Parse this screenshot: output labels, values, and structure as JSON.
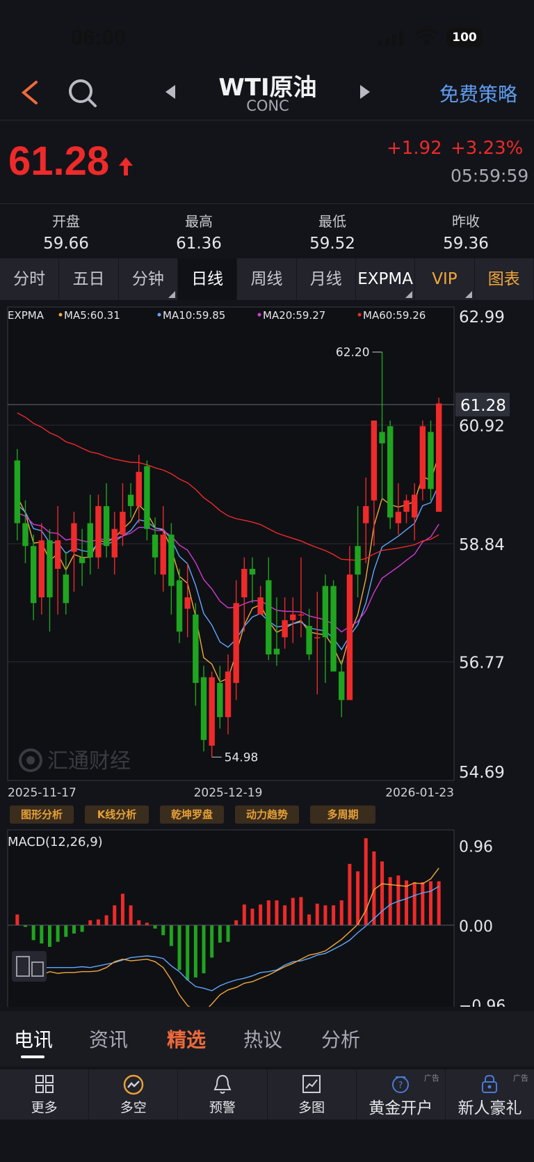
{
  "status": {
    "time": "06:00",
    "battery": "100"
  },
  "header": {
    "title": "WTI原油",
    "subtitle": "CONC",
    "strategy_label": "免费策略"
  },
  "quote": {
    "price": "61.28",
    "change": "+1.92",
    "change_pct": "+3.23%",
    "time": "05:59:59",
    "up_color": "#ef2a2a",
    "down_color": "#1fa51f"
  },
  "stats": [
    {
      "label": "开盘",
      "value": "59.66"
    },
    {
      "label": "最高",
      "value": "61.36"
    },
    {
      "label": "最低",
      "value": "59.52"
    },
    {
      "label": "昨收",
      "value": "59.36"
    }
  ],
  "period_tabs": [
    {
      "label": "分时"
    },
    {
      "label": "五日"
    },
    {
      "label": "分钟"
    },
    {
      "label": "日线",
      "active": true
    },
    {
      "label": "周线"
    },
    {
      "label": "月线"
    },
    {
      "label": "EXPMA"
    },
    {
      "label": "VIP"
    },
    {
      "label": "图表"
    }
  ],
  "chart_data": [
    {
      "type": "candlestick",
      "indicator": "EXPMA",
      "legend": [
        {
          "label": "MA5:60.31",
          "color": "#f2a93b"
        },
        {
          "label": "MA10:59.85",
          "color": "#5fa8ff"
        },
        {
          "label": "MA20:59.27",
          "color": "#d63ad6"
        },
        {
          "label": "MA60:59.26",
          "color": "#ef2a2a"
        }
      ],
      "y_ticks": [
        "62.99",
        "60.92",
        "58.84",
        "56.77",
        "54.69"
      ],
      "ylim": [
        54.69,
        62.99
      ],
      "current_price_label": "61.28",
      "x_ticks": [
        "2025-11-17",
        "2025-12-19",
        "2026-01-23"
      ],
      "max_label": "62.20",
      "min_label": "54.98",
      "watermark": "汇通财经",
      "candles": [
        [
          60.3,
          59.2,
          60.5,
          58.9
        ],
        [
          59.2,
          58.8,
          59.6,
          58.5
        ],
        [
          58.8,
          57.8,
          59.0,
          57.5
        ],
        [
          57.9,
          58.9,
          59.2,
          57.6
        ],
        [
          58.9,
          57.9,
          59.1,
          57.3
        ],
        [
          58.4,
          58.9,
          59.5,
          57.6
        ],
        [
          58.3,
          57.8,
          58.7,
          57.6
        ],
        [
          58.7,
          59.2,
          59.4,
          58.0
        ],
        [
          58.6,
          58.5,
          59.1,
          58.1
        ],
        [
          59.2,
          58.6,
          59.7,
          58.3
        ],
        [
          58.6,
          59.5,
          59.7,
          58.4
        ],
        [
          59.5,
          58.8,
          59.9,
          58.6
        ],
        [
          58.6,
          59.1,
          59.4,
          58.3
        ],
        [
          59.0,
          59.4,
          59.9,
          58.8
        ],
        [
          59.7,
          59.5,
          59.9,
          59.3
        ],
        [
          59.5,
          60.1,
          60.4,
          59.2
        ],
        [
          60.2,
          59.1,
          60.3,
          58.9
        ],
        [
          59.0,
          58.6,
          59.3,
          58.3
        ],
        [
          58.3,
          59.0,
          59.5,
          58.0
        ],
        [
          59.0,
          58.1,
          59.2,
          57.6
        ],
        [
          58.2,
          57.3,
          58.4,
          57.1
        ],
        [
          57.7,
          57.9,
          58.5,
          57.2
        ],
        [
          57.6,
          56.4,
          57.8,
          56.0
        ],
        [
          56.5,
          55.4,
          56.7,
          55.2
        ],
        [
          55.3,
          56.5,
          56.6,
          55.1
        ],
        [
          56.4,
          55.8,
          56.7,
          55.6
        ],
        [
          55.8,
          56.6,
          56.9,
          55.5
        ],
        [
          56.4,
          57.8,
          58.2,
          56.1
        ],
        [
          57.9,
          58.4,
          58.6,
          57.3
        ],
        [
          58.4,
          58.3,
          58.6,
          57.8
        ],
        [
          57.6,
          57.9,
          58.1,
          57.6
        ],
        [
          58.2,
          56.9,
          58.6,
          56.8
        ],
        [
          57.0,
          56.9,
          57.9,
          56.7
        ],
        [
          57.2,
          57.5,
          57.9,
          57.0
        ],
        [
          57.5,
          57.6,
          57.9,
          57.1
        ],
        [
          57.6,
          57.6,
          58.6,
          57.2
        ],
        [
          57.4,
          56.9,
          57.7,
          56.8
        ],
        [
          57.2,
          57.2,
          58.0,
          56.2
        ],
        [
          58.1,
          57.2,
          58.3,
          56.4
        ],
        [
          58.1,
          56.6,
          58.2,
          56.6
        ],
        [
          56.6,
          56.1,
          56.8,
          55.8
        ],
        [
          56.1,
          58.3,
          58.8,
          56.4
        ],
        [
          58.8,
          58.3,
          59.5,
          57.9
        ],
        [
          59.2,
          59.5,
          60.0,
          58.5
        ],
        [
          59.6,
          61.0,
          61.0,
          58.8
        ],
        [
          60.8,
          60.6,
          62.2,
          59.6
        ],
        [
          60.9,
          59.3,
          61.0,
          59.1
        ],
        [
          59.2,
          59.4,
          59.9,
          59.0
        ],
        [
          59.4,
          59.6,
          59.7,
          59.2
        ],
        [
          59.3,
          59.7,
          59.9,
          58.9
        ],
        [
          59.8,
          60.9,
          61.0,
          59.6
        ],
        [
          60.8,
          59.8,
          61.0,
          59.6
        ],
        [
          59.4,
          61.3,
          61.4,
          59.5
        ]
      ]
    },
    {
      "type": "bar",
      "indicator": "MACD",
      "title": "MACD(12,26,9)",
      "y_ticks": [
        "0.96",
        "0.00",
        "-0.96"
      ],
      "ylim": [
        -1.0,
        1.15
      ],
      "histogram": [
        0.13,
        -0.02,
        -0.18,
        -0.22,
        -0.26,
        -0.2,
        -0.14,
        -0.1,
        -0.08,
        0.06,
        0.07,
        0.12,
        0.24,
        0.38,
        0.24,
        0.06,
        0.03,
        -0.04,
        -0.12,
        -0.25,
        -0.54,
        -0.66,
        -0.63,
        -0.58,
        -0.39,
        -0.21,
        -0.2,
        0.06,
        0.25,
        0.2,
        0.25,
        0.3,
        0.3,
        0.24,
        0.33,
        0.34,
        0.13,
        0.26,
        0.24,
        0.24,
        0.3,
        0.74,
        0.65,
        1.05,
        0.89,
        0.77,
        0.58,
        0.6,
        0.54,
        0.52,
        0.52,
        0.53,
        0.53
      ],
      "dif": [
        -0.38,
        -0.46,
        -0.58,
        -0.6,
        -0.56,
        -0.58,
        -0.57,
        -0.57,
        -0.56,
        -0.56,
        -0.55,
        -0.51,
        -0.44,
        -0.41,
        -0.43,
        -0.42,
        -0.41,
        -0.44,
        -0.51,
        -0.66,
        -0.84,
        -0.97,
        -1.03,
        -1.05,
        -0.95,
        -0.84,
        -0.78,
        -0.75,
        -0.7,
        -0.68,
        -0.64,
        -0.6,
        -0.55,
        -0.5,
        -0.46,
        -0.41,
        -0.36,
        -0.34,
        -0.31,
        -0.24,
        -0.17,
        -0.08,
        0.01,
        0.18,
        0.43,
        0.5,
        0.49,
        0.48,
        0.47,
        0.51,
        0.5,
        0.56,
        0.69
      ],
      "dea": [
        -0.43,
        -0.49,
        -0.5,
        -0.51,
        -0.51,
        -0.51,
        -0.51,
        -0.51,
        -0.5,
        -0.51,
        -0.49,
        -0.47,
        -0.45,
        -0.42,
        -0.39,
        -0.38,
        -0.37,
        -0.38,
        -0.4,
        -0.49,
        -0.56,
        -0.66,
        -0.74,
        -0.76,
        -0.79,
        -0.73,
        -0.69,
        -0.66,
        -0.64,
        -0.61,
        -0.57,
        -0.56,
        -0.54,
        -0.48,
        -0.44,
        -0.43,
        -0.4,
        -0.36,
        -0.34,
        -0.29,
        -0.24,
        -0.18,
        -0.09,
        -0.01,
        0.08,
        0.17,
        0.25,
        0.29,
        0.32,
        0.36,
        0.39,
        0.41,
        0.47
      ]
    }
  ],
  "tools": [
    "图形分析",
    "K线分析",
    "乾坤罗盘",
    "动力趋势",
    "多周期"
  ],
  "news_tabs": [
    {
      "label": "电讯",
      "active": true
    },
    {
      "label": "资讯"
    },
    {
      "label": "精选",
      "hot": true
    },
    {
      "label": "热议"
    },
    {
      "label": "分析"
    }
  ],
  "toolbar": [
    {
      "label": "更多",
      "icon": "grid-icon"
    },
    {
      "label": "多空",
      "icon": "trend-circle-icon"
    },
    {
      "label": "预警",
      "icon": "bell-icon"
    },
    {
      "label": "多图",
      "icon": "multi-chart-icon"
    },
    {
      "label": "黄金开户",
      "icon": "gold-account-icon",
      "ad": "广告"
    },
    {
      "label": "新人豪礼",
      "icon": "gift-icon",
      "ad": "广告"
    }
  ]
}
